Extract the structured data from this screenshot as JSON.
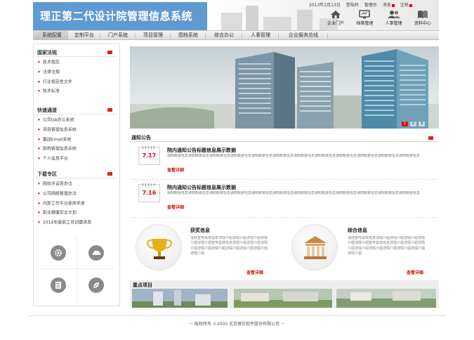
{
  "app_title": "理正第二代设计院管理信息系统",
  "topbar": {
    "date": "2013年2月13日",
    "login": "登陆码",
    "admin": "管理员",
    "message": "消息",
    "logout": "注销"
  },
  "quick_links": [
    {
      "label": "企业门户",
      "icon": "house-icon"
    },
    {
      "label": "档案管理",
      "icon": "monitor-icon"
    },
    {
      "label": "人事管理",
      "icon": "users-icon"
    },
    {
      "label": "资料中心",
      "icon": "book-icon"
    }
  ],
  "nav": [
    {
      "label": "系统配置",
      "active": true
    },
    {
      "label": "定制平台"
    },
    {
      "label": "门户系统"
    },
    {
      "label": "项目管理"
    },
    {
      "label": "图档系统"
    },
    {
      "label": "综合办公"
    },
    {
      "label": "人事管理"
    },
    {
      "label": "企业服务总线"
    }
  ],
  "sidebar": {
    "sections": [
      {
        "title": "国家法规",
        "items": [
          "技术规范",
          "法律法规",
          "行业规范性文件",
          "技术标准"
        ]
      },
      {
        "title": "快速通道",
        "items": [
          "公司OA办公系统",
          "项目管理信息系统",
          "集团Email系统",
          "图档管理信息系统",
          "个人信息平台"
        ]
      },
      {
        "title": "下载专区",
        "items": [
          "网校评设表办法",
          "公司网络管理办法",
          "内部工作平台使用手册",
          "职业健康安全计划",
          "2014年度职工培训需求表"
        ]
      }
    ],
    "tiles": [
      {
        "icon": "gear-icon"
      },
      {
        "icon": "car-icon"
      },
      {
        "icon": "document-icon"
      },
      {
        "icon": "leaf-icon"
      }
    ]
  },
  "banner": {
    "pages": [
      "1",
      "2",
      "3"
    ],
    "active_page": "1"
  },
  "notice": {
    "title": "通知公告",
    "items": [
      {
        "date": "7.17",
        "title": "院内通知公告标题信息展示数据",
        "body": "通知概要信息通知概要信息通知概要信息通知概要信息通知概要信息通知概要信息通知概要信息通知概要信息通知概要信息通知概要信息通知概要信息通知概要信息",
        "more": "查看详细"
      },
      {
        "date": "7.16",
        "title": "院内通知公告标题信息展示数据",
        "body": "通知概要信息通知概要信息通知概要信息通知概要信息通知概要信息通知概要信息通知概要信息通知概要信息通知概要信息通知概要信息通知概要信息通知概要信息",
        "more": "查看详细"
      }
    ]
  },
  "info_blocks": [
    {
      "title": "获奖信息",
      "icon": "trophy-icon",
      "body": "活动宣传具体信息详情介绍详情介绍详情介绍详情介绍详情介绍宣传具体信息详情介绍详情介绍详情介绍详情介绍详情介绍详情介绍详情介绍详情介绍详情介绍",
      "more": "查看详细"
    },
    {
      "title": "综合信息",
      "icon": "bank-icon",
      "body": "活动宣传具体信息详情介绍详情介绍详情介绍详情介绍详情介绍宣传具体信息详情介绍详情介绍详情介绍详情介绍详情介绍详情介绍详情介绍详情介绍详情介绍",
      "more": "查看详细"
    }
  ],
  "key_projects": {
    "title": "重点项目"
  },
  "footer": "－ 版权所有 ©2000 北京理正软件股份有限公司 －",
  "colors": {
    "brand": "#5f9ad1",
    "accent_red": "#cc1111",
    "nav_bg": "#dcdcdc"
  }
}
